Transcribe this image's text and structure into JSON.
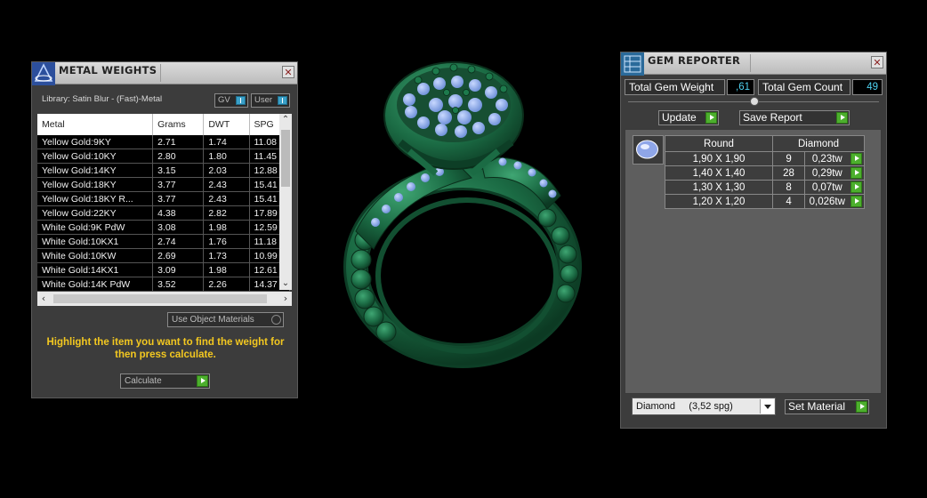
{
  "metal_weights": {
    "title": "METAL WEIGHTS",
    "library": "Library: Satin Blur - (Fast)-Metal",
    "gv_label": "GV",
    "user_label": "User",
    "columns": [
      "Metal",
      "Grams",
      "DWT",
      "SPG"
    ],
    "rows": [
      [
        "Yellow Gold:9KY",
        "2.71",
        "1.74",
        "11.08"
      ],
      [
        "Yellow Gold:10KY",
        "2.80",
        "1.80",
        "11.45"
      ],
      [
        "Yellow Gold:14KY",
        "3.15",
        "2.03",
        "12.88"
      ],
      [
        "Yellow Gold:18KY",
        "3.77",
        "2.43",
        "15.41"
      ],
      [
        "Yellow Gold:18KY R...",
        "3.77",
        "2.43",
        "15.41"
      ],
      [
        "Yellow Gold:22KY",
        "4.38",
        "2.82",
        "17.89"
      ],
      [
        "White Gold:9K PdW",
        "3.08",
        "1.98",
        "12.59"
      ],
      [
        "White Gold:10KX1",
        "2.74",
        "1.76",
        "11.18"
      ],
      [
        "White Gold:10KW",
        "2.69",
        "1.73",
        "10.99"
      ],
      [
        "White Gold:14KX1",
        "3.09",
        "1.98",
        "12.61"
      ],
      [
        "White Gold:14K PdW",
        "3.52",
        "2.26",
        "14.37"
      ]
    ],
    "use_object_materials": "Use Object Materials",
    "hint": "Highlight the item you want to find the weight for then press calculate.",
    "calculate_label": "Calculate"
  },
  "gem_reporter": {
    "title": "GEM REPORTER",
    "total_gem_weight_label": "Total Gem Weight",
    "total_gem_weight_value": ",61",
    "total_gem_count_label": "Total Gem Count",
    "total_gem_count_value": "49",
    "update_label": "Update",
    "save_report_label": "Save Report",
    "columns": [
      "Round",
      "Diamond"
    ],
    "rows": [
      [
        "1,90 X 1,90",
        "9",
        "0,23tw"
      ],
      [
        "1,40 X 1,40",
        "28",
        "0,29tw"
      ],
      [
        "1,30 X 1,30",
        "8",
        "0,07tw"
      ],
      [
        "1,20 X 1,20",
        "4",
        "0,026tw"
      ]
    ],
    "material_select": "Diamond     (3,52 spg)",
    "set_material_label": "Set Material"
  },
  "colors": {
    "ring_metal": "#1f6e4a",
    "gem_blue": "#8fb0f0",
    "hint_yellow": "#f3c820",
    "value_cyan": "#4fd1f0",
    "accent_green": "#4caf2d"
  }
}
